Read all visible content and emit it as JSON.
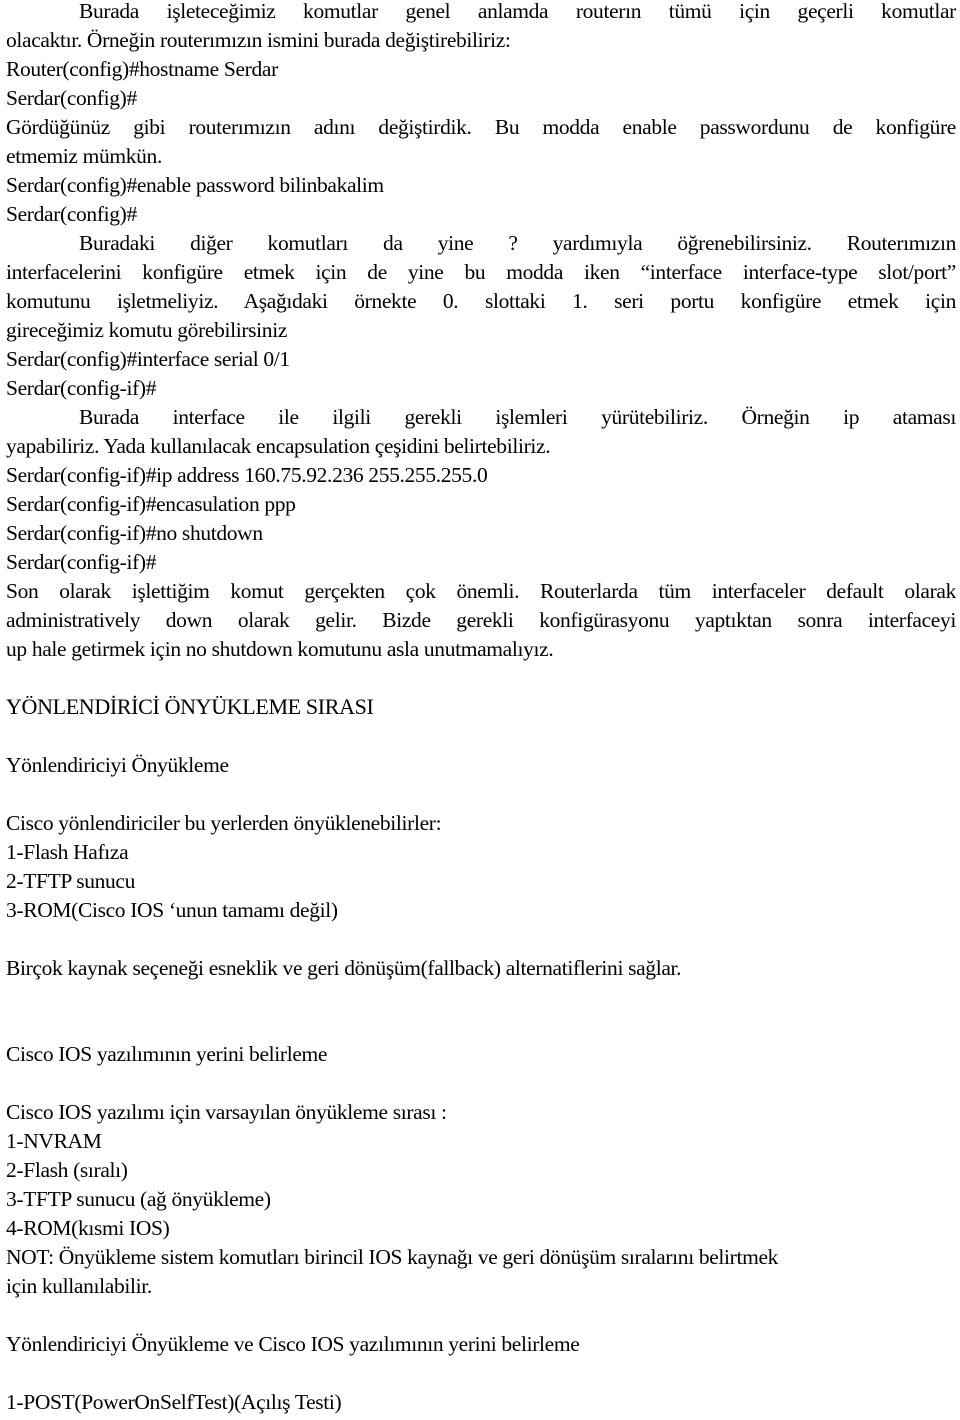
{
  "document": {
    "lines": [
      "Burada işleteceğimiz komutlar genel anlamda routerın tümü için geçerli komutlar",
      "olacaktır. Örneğin routerımızın ismini burada değiştirebiliriz:",
      "Router(config)#hostname Serdar",
      "Serdar(config)#",
      "Gördüğünüz gibi routerımızın adını değiştirdik. Bu modda enable passwordunu de konfigüre",
      "etmemiz mümkün.",
      "Serdar(config)#enable password bilinbakalim",
      "Serdar(config)#",
      "Buradaki diğer komutları da yine ? yardımıyla öğrenebilirsiniz. Routerımızın",
      "interfacelerini konfigüre etmek için de yine bu modda iken “interface interface-type slot/port”",
      "komutunu işletmeliyiz. Aşağıdaki örnekte 0. slottaki 1. seri portu konfigüre etmek için",
      "gireceğimiz komutu görebilirsiniz",
      "Serdar(config)#interface serial 0/1",
      "Serdar(config-if)#",
      "Burada interface ile ilgili gerekli işlemleri yürütebiliriz. Örneğin ip ataması",
      "yapabiliriz. Yada kullanılacak encapsulation çeşidini belirtebiliriz.",
      "Serdar(config-if)#ip address 160.75.92.236 255.255.255.0",
      "Serdar(config-if)#encasulation ppp",
      "Serdar(config-if)#no shutdown",
      "Serdar(config-if)#",
      "Son olarak işlettiğim komut gerçekten çok önemli. Routerlarda tüm interfaceler default olarak",
      "administratively down olarak gelir. Bizde gerekli konfigürasyonu yaptıktan sonra interfaceyi",
      "up hale getirmek için no shutdown komutunu asla unutmamalıyız.",
      "YÖNLENDİRİCİ ÖNYÜKLEME SIRASI",
      "Yönlendiriciyi Önyükleme",
      "Cisco yönlendiriciler bu yerlerden önyüklenebilirler:",
      "1-Flash Hafıza",
      "2-TFTP sunucu",
      "3-ROM(Cisco IOS ‘unun tamamı değil)",
      "Birçok kaynak seçeneği esneklik ve geri dönüşüm(fallback) alternatiflerini sağlar.",
      "Cisco IOS yazılımının yerini belirleme",
      "Cisco IOS yazılımı için varsayılan önyükleme sırası :",
      "1-NVRAM",
      "2-Flash (sıralı)",
      "3-TFTP sunucu (ağ önyükleme)",
      "4-ROM(kısmi IOS)",
      "NOT: Önyükleme sistem komutları birincil IOS kaynağı ve geri dönüşüm sıralarını belirtmek",
      "için kullanılabilir.",
      "Yönlendiriciyi Önyükleme ve Cisco IOS yazılımının yerini belirleme",
      "1-POST(PowerOnSelfTest)(Açılış Testi)"
    ]
  }
}
